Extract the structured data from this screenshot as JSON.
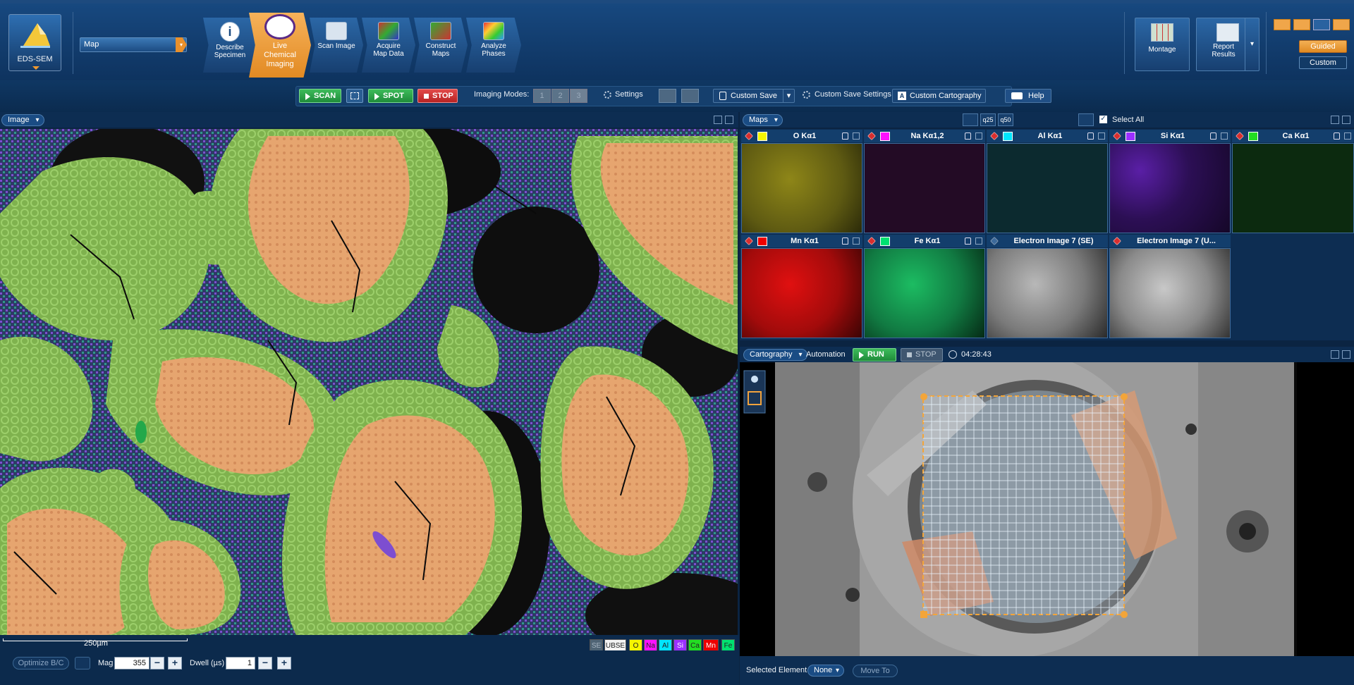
{
  "app": {
    "logo_label": "EDS-SEM",
    "mode_select": "Map"
  },
  "workflow_steps": [
    {
      "label": "Describe Specimen",
      "icon": "info-icon"
    },
    {
      "label": "Live Chemical Imaging",
      "icon": "magnifier-icon"
    },
    {
      "label": "Scan Image",
      "icon": "scan-image-icon"
    },
    {
      "label": "Acquire Map Data",
      "icon": "acquire-map-icon"
    },
    {
      "label": "Construct Maps",
      "icon": "construct-maps-icon"
    },
    {
      "label": "Analyze Phases",
      "icon": "analyze-phases-icon"
    }
  ],
  "right_ribbon": {
    "montage": "Montage",
    "report": "Report Results",
    "guided": "Guided",
    "custom": "Custom"
  },
  "toolbar": {
    "scan": "SCAN",
    "spot": "SPOT",
    "stop": "STOP",
    "imaging_modes": "Imaging Modes:",
    "mode_buttons": [
      "1",
      "2",
      "3"
    ],
    "settings": "Settings",
    "custom_save": "Custom Save",
    "custom_save_settings": "Custom Save Settings",
    "custom_cartography": "Custom Cartography",
    "help": "Help"
  },
  "image_panel": {
    "title": "Image",
    "scale": "250µm"
  },
  "image_toggles": [
    "SE",
    "UBSE",
    "O",
    "Na",
    "Al",
    "Si",
    "Ca",
    "Mn",
    "Fe"
  ],
  "bottom": {
    "optimize": "Optimize B/C",
    "mag_label": "Mag",
    "mag_value": "355",
    "dwell_label": "Dwell (µs)",
    "dwell_value": "1"
  },
  "maps_panel": {
    "title": "Maps",
    "zoom_labels": [
      "25",
      "50"
    ],
    "select_all": "Select All",
    "tiles": [
      {
        "name": "O Kα1",
        "swatch": "#f5f500"
      },
      {
        "name": "Na Kα1,2",
        "swatch": "#ff10ff"
      },
      {
        "name": "Al Kα1",
        "swatch": "#00e5ff"
      },
      {
        "name": "Si Kα1",
        "swatch": "#9b30ff"
      },
      {
        "name": "Ca Kα1",
        "swatch": "#22dd22"
      },
      {
        "name": "Mn Kα1",
        "swatch": "#ee0000"
      },
      {
        "name": "Fe Kα1",
        "swatch": "#00e070"
      },
      {
        "name": "Electron Image 7 (SE)",
        "swatch": ""
      },
      {
        "name": "Electron Image 7 (U...",
        "swatch": ""
      }
    ]
  },
  "cartography": {
    "dropdown": "Cartography",
    "automation": "Automation",
    "run": "RUN",
    "stop": "STOP",
    "time": "04:28:43",
    "selected_element_label": "Selected Element",
    "selected_element_value": "None",
    "move_to": "Move To"
  }
}
